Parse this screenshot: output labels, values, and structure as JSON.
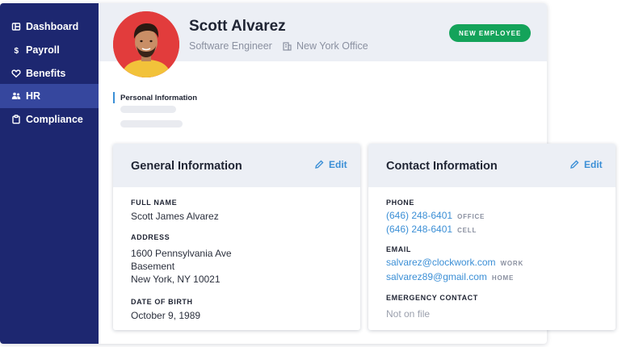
{
  "sidebar": {
    "items": [
      {
        "label": "Dashboard",
        "icon": "dashboard-icon",
        "active": false
      },
      {
        "label": "Payroll",
        "icon": "dollar-icon",
        "active": false
      },
      {
        "label": "Benefits",
        "icon": "heart-icon",
        "active": false
      },
      {
        "label": "HR",
        "icon": "people-icon",
        "active": true
      },
      {
        "label": "Compliance",
        "icon": "clipboard-icon",
        "active": false
      }
    ]
  },
  "employee": {
    "name": "Scott Alvarez",
    "title": "Software Engineer",
    "office": "New York Office",
    "badge": "NEW EMPLOYEE"
  },
  "section": {
    "label": "Personal Information"
  },
  "general": {
    "title": "General Information",
    "edit_label": "Edit",
    "full_name_label": "FULL NAME",
    "full_name": "Scott James Alvarez",
    "address_label": "ADDRESS",
    "address_line1": "1600 Pennsylvania Ave",
    "address_line2": "Basement",
    "address_line3": "New York, NY 10021",
    "dob_label": "DATE OF BIRTH",
    "dob": "October 9, 1989"
  },
  "contact": {
    "title": "Contact Information",
    "edit_label": "Edit",
    "phone_label": "PHONE",
    "phones": [
      {
        "number": "(646) 248-6401",
        "tag": "OFFICE"
      },
      {
        "number": "(646) 248-6401",
        "tag": "CELL"
      }
    ],
    "email_label": "EMAIL",
    "emails": [
      {
        "address": "salvarez@clockwork.com",
        "tag": "WORK"
      },
      {
        "address": "salvarez89@gmail.com",
        "tag": "HOME"
      }
    ],
    "emergency_label": "EMERGENCY CONTACT",
    "emergency_value": "Not on file"
  },
  "colors": {
    "sidebar": "#1d2770",
    "sidebar_active": "#36479e",
    "accent": "#3b8fd6",
    "badge": "#14a35a",
    "avatar_bg": "#e23c3c"
  }
}
